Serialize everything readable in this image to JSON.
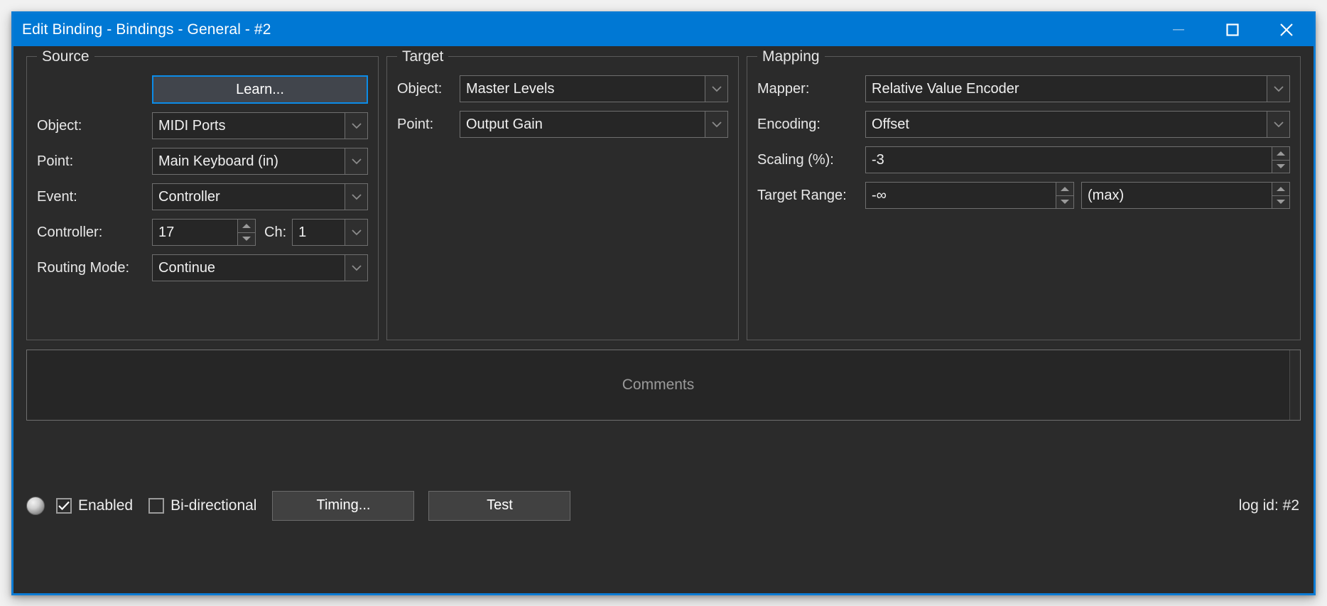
{
  "window": {
    "title": "Edit Binding - Bindings - General - #2",
    "accent_color": "#0078d4",
    "border_color": "#0b7bd4",
    "background_color": "#2b2b2b",
    "controls": {
      "minimize_label": "Minimize",
      "maximize_label": "Maximize",
      "close_label": "Close"
    }
  },
  "source": {
    "legend": "Source",
    "learn_label": "Learn...",
    "object": {
      "label": "Object:",
      "value": "MIDI Ports"
    },
    "point": {
      "label": "Point:",
      "value": "Main Keyboard (in)"
    },
    "event": {
      "label": "Event:",
      "value": "Controller"
    },
    "controller": {
      "label": "Controller:",
      "value": "17"
    },
    "channel": {
      "label": "Ch:",
      "value": "1"
    },
    "routing_mode": {
      "label": "Routing Mode:",
      "value": "Continue"
    }
  },
  "target": {
    "legend": "Target",
    "object": {
      "label": "Object:",
      "value": "Master Levels"
    },
    "point": {
      "label": "Point:",
      "value": "Output Gain"
    }
  },
  "mapping": {
    "legend": "Mapping",
    "mapper": {
      "label": "Mapper:",
      "value": "Relative Value Encoder"
    },
    "encoding": {
      "label": "Encoding:",
      "value": "Offset"
    },
    "scaling": {
      "label": "Scaling (%):",
      "value": "-3"
    },
    "target_range": {
      "label": "Target Range:",
      "min_value": "-∞",
      "max_value": "(max)"
    }
  },
  "comments": {
    "placeholder": "Comments",
    "value": ""
  },
  "bottom": {
    "led_name": "status-led",
    "enabled": {
      "label": "Enabled",
      "checked": true
    },
    "bidirectional": {
      "label": "Bi-directional",
      "checked": false
    },
    "timing_label": "Timing...",
    "test_label": "Test",
    "log_id": "log id: #2"
  }
}
